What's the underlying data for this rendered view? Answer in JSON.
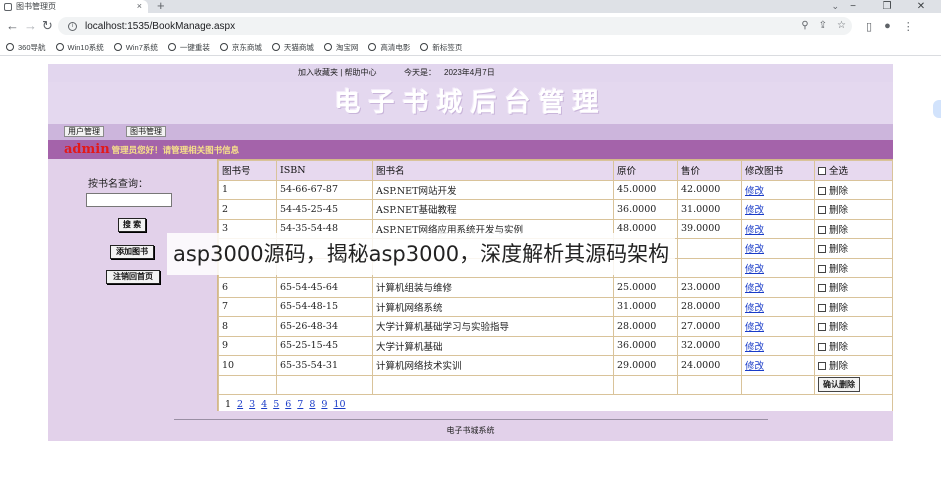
{
  "browser": {
    "tab_title": "图书管理页",
    "tab_close": "×",
    "new_tab": "+",
    "url": "localhost:1535/BookManage.aspx",
    "bookmarks": [
      "360导航",
      "Win10系统",
      "Win7系统",
      "一键重装",
      "京东商城",
      "天猫商城",
      "淘宝网",
      "高清电影",
      "新标签页"
    ]
  },
  "page": {
    "top_links": "加入收藏夹 | 帮助中心",
    "today_label": "今天是：",
    "today_value": "2023年4月7日",
    "banner_title": "电子书城后台管理",
    "menu": [
      "用户管理",
      "图书管理"
    ],
    "admin_name": "admin",
    "admin_message": "管理员您好！请管理相关图书信息",
    "sidebar": {
      "search_label": "按书名查询：",
      "search_value": "",
      "search_button": "搜 索",
      "add_button": "添加图书",
      "logout_button": "注销回首页"
    },
    "table": {
      "headers": [
        "图书号",
        "ISBN",
        "图书名",
        "原价",
        "售价",
        "修改图书",
        "全选"
      ],
      "edit_label": "修改",
      "delete_label": "删除",
      "rows": [
        {
          "id": "1",
          "isbn": "54-66-67-87",
          "name": "ASP.NET网站开发",
          "price": "45.0000",
          "sale": "42.0000"
        },
        {
          "id": "2",
          "isbn": "54-45-25-45",
          "name": "ASP.NET基础教程",
          "price": "36.0000",
          "sale": "31.0000"
        },
        {
          "id": "3",
          "isbn": "54-35-54-48",
          "name": "ASP.NET网络应用系统开发与实例",
          "price": "48.0000",
          "sale": "39.0000"
        },
        {
          "id": "",
          "isbn": "",
          "name": "",
          "price": "",
          "sale": ""
        },
        {
          "id": "",
          "isbn": "",
          "name": "",
          "price": "",
          "sale": ""
        },
        {
          "id": "6",
          "isbn": "65-54-45-64",
          "name": "计算机组装与维修",
          "price": "25.0000",
          "sale": "23.0000"
        },
        {
          "id": "7",
          "isbn": "65-54-48-15",
          "name": "计算机网络系统",
          "price": "31.0000",
          "sale": "28.0000"
        },
        {
          "id": "8",
          "isbn": "65-26-48-34",
          "name": "大学计算机基础学习与实验指导",
          "price": "28.0000",
          "sale": "27.0000"
        },
        {
          "id": "9",
          "isbn": "65-25-15-45",
          "name": "大学计算机基础",
          "price": "36.0000",
          "sale": "32.0000"
        },
        {
          "id": "10",
          "isbn": "65-35-54-31",
          "name": "计算机网络技术实训",
          "price": "29.0000",
          "sale": "24.0000"
        }
      ],
      "confirm_delete": "确认删除",
      "pages": [
        "1",
        "2",
        "3",
        "4",
        "5",
        "6",
        "7",
        "8",
        "9",
        "10"
      ],
      "current_page": "1"
    },
    "footer": "电子书城系统"
  },
  "overlay_caption": "asp3000源码，揭秘asp3000，深度解析其源码架构"
}
